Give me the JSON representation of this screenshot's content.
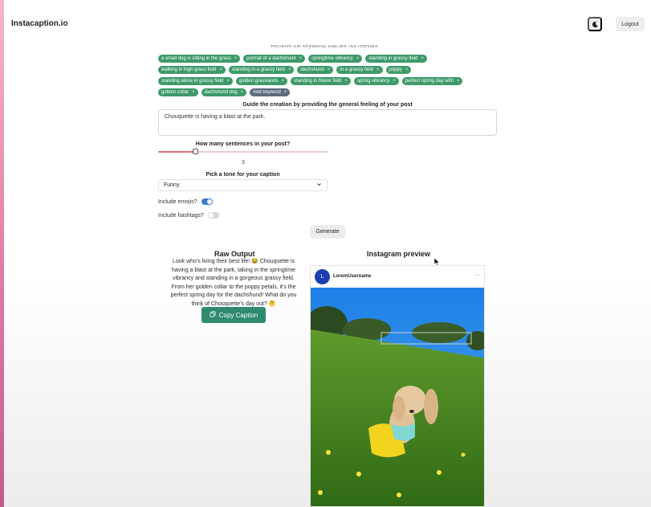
{
  "app": {
    "title": "Instacaption.io",
    "logout_label": "Logout"
  },
  "keywords": {
    "hint": "Remove the keywords that are not relevant",
    "items": [
      "a small dog is sitting in the grass",
      "portrait of a dachshund",
      "springtime vibrancy",
      "standing in grassy field",
      "walking in high grass field",
      "standing in a grassy field",
      "dachshund",
      "in a grassy field",
      "poppy",
      "standing alone in grassy field",
      "golden grasslands",
      "standing in flower field",
      "spring vibrancy",
      "perfect spring day with",
      "golden collar",
      "dachshund dog"
    ],
    "add_label": "Add keyword",
    "remove_symbol": "×",
    "add_symbol": "+"
  },
  "feeling": {
    "label": "Guide the creation by providing the general feeling of your post",
    "value": "Chouquette is having a blast at the park."
  },
  "sentences": {
    "label": "How many sentences in your post?",
    "value": "3",
    "fraction": 0.22
  },
  "tone": {
    "label": "Pick a tone for your caption",
    "selected": "Funny"
  },
  "options": {
    "emojis_label": "Include emojis?",
    "emojis_on": true,
    "hashtags_label": "Include hashtags?",
    "hashtags_on": false
  },
  "generate_label": "Generate",
  "raw_output": {
    "title": "Raw Output",
    "text": "Look who's living their best life! 😂 Chouquette is having a blast at the park, taking in the springtime vibrancy and standing in a gorgeous grassy field. From her golden collar to the poppy petals, it's the perfect spring day for the dachshund! What do you think of Chouquette's day out? 🤔",
    "copy_label": "Copy Caption"
  },
  "preview": {
    "title": "Instagram preview",
    "avatar_letter": "L",
    "username": "LoremUsername",
    "more": "···"
  },
  "colors": {
    "keyword_chip": "#3d9a6a",
    "add_chip": "#5d6b7e",
    "copy_button": "#2f8a70",
    "toggle_on": "#3b7fcf",
    "slider_fill": "#e0726f",
    "avatar": "#1d3fb0"
  },
  "icons": {
    "theme": "moon-icon",
    "chevron": "chevron-down-icon",
    "copy": "copy-icon",
    "more": "more-icon"
  }
}
